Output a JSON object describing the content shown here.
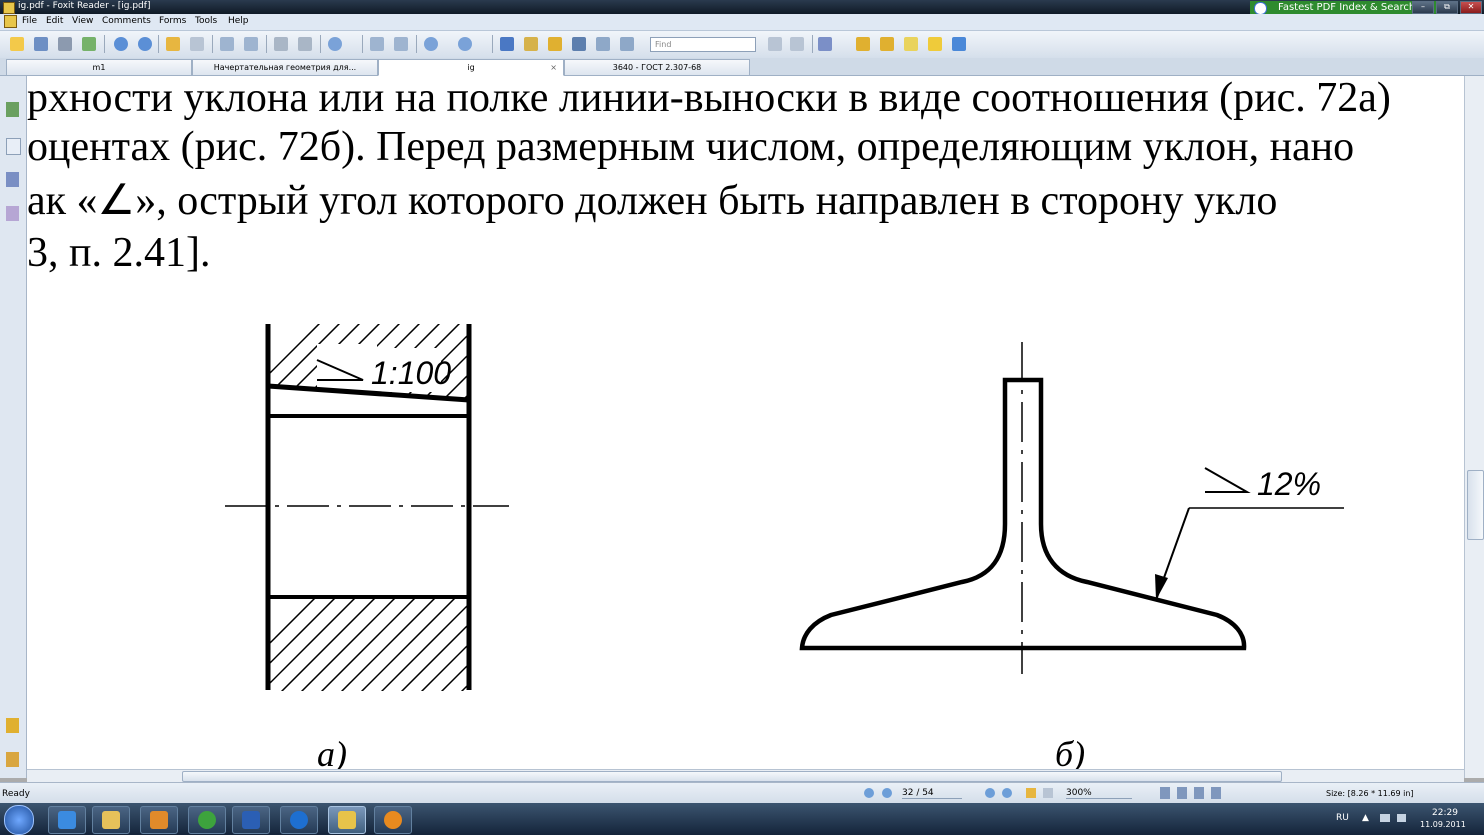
{
  "window": {
    "title": "ig.pdf - Foxit Reader - [ig.pdf]",
    "controls": [
      "–",
      "⧉",
      "✕"
    ]
  },
  "menu": [
    "File",
    "Edit",
    "View",
    "Comments",
    "Forms",
    "Tools",
    "Help"
  ],
  "ad": {
    "label": "Fastest PDF Index & Search"
  },
  "toolbar": {
    "find_placeholder": "Find"
  },
  "tabs": [
    {
      "label": "m1",
      "active": false
    },
    {
      "label": "Начертательная геометрия для...",
      "active": false
    },
    {
      "label": "ig",
      "active": true,
      "close": "×"
    },
    {
      "label": "3640 - ГОСТ 2.307-68",
      "active": false
    }
  ],
  "document": {
    "lines": [
      "рхности уклона или на полке линии-выноски в виде соотношения (рис. 72а)",
      "оцентах (рис. 72б). Перед размерным числом, определяющим уклон, нано",
      "ак «∠», острый угол которого должен быть направлен в сторону укло",
      "3, п. 2.41]."
    ],
    "figure_a": {
      "slope_label": "1:100",
      "caption": "а)"
    },
    "figure_b": {
      "slope_label": "12%",
      "caption": "б)"
    }
  },
  "status": {
    "ready": "Ready",
    "page": "32 / 54",
    "zoom": "300%",
    "size": "Size: [8.26 * 11.69 in]"
  },
  "taskbar": {
    "lang": "RU",
    "time": "22:29",
    "date": "11.09.2011",
    "apps": [
      "start-orb",
      "internet-explorer",
      "file-explorer",
      "media-player",
      "utorrent",
      "word",
      "kmplayer",
      "foxit-reader",
      "mail-agent"
    ]
  }
}
